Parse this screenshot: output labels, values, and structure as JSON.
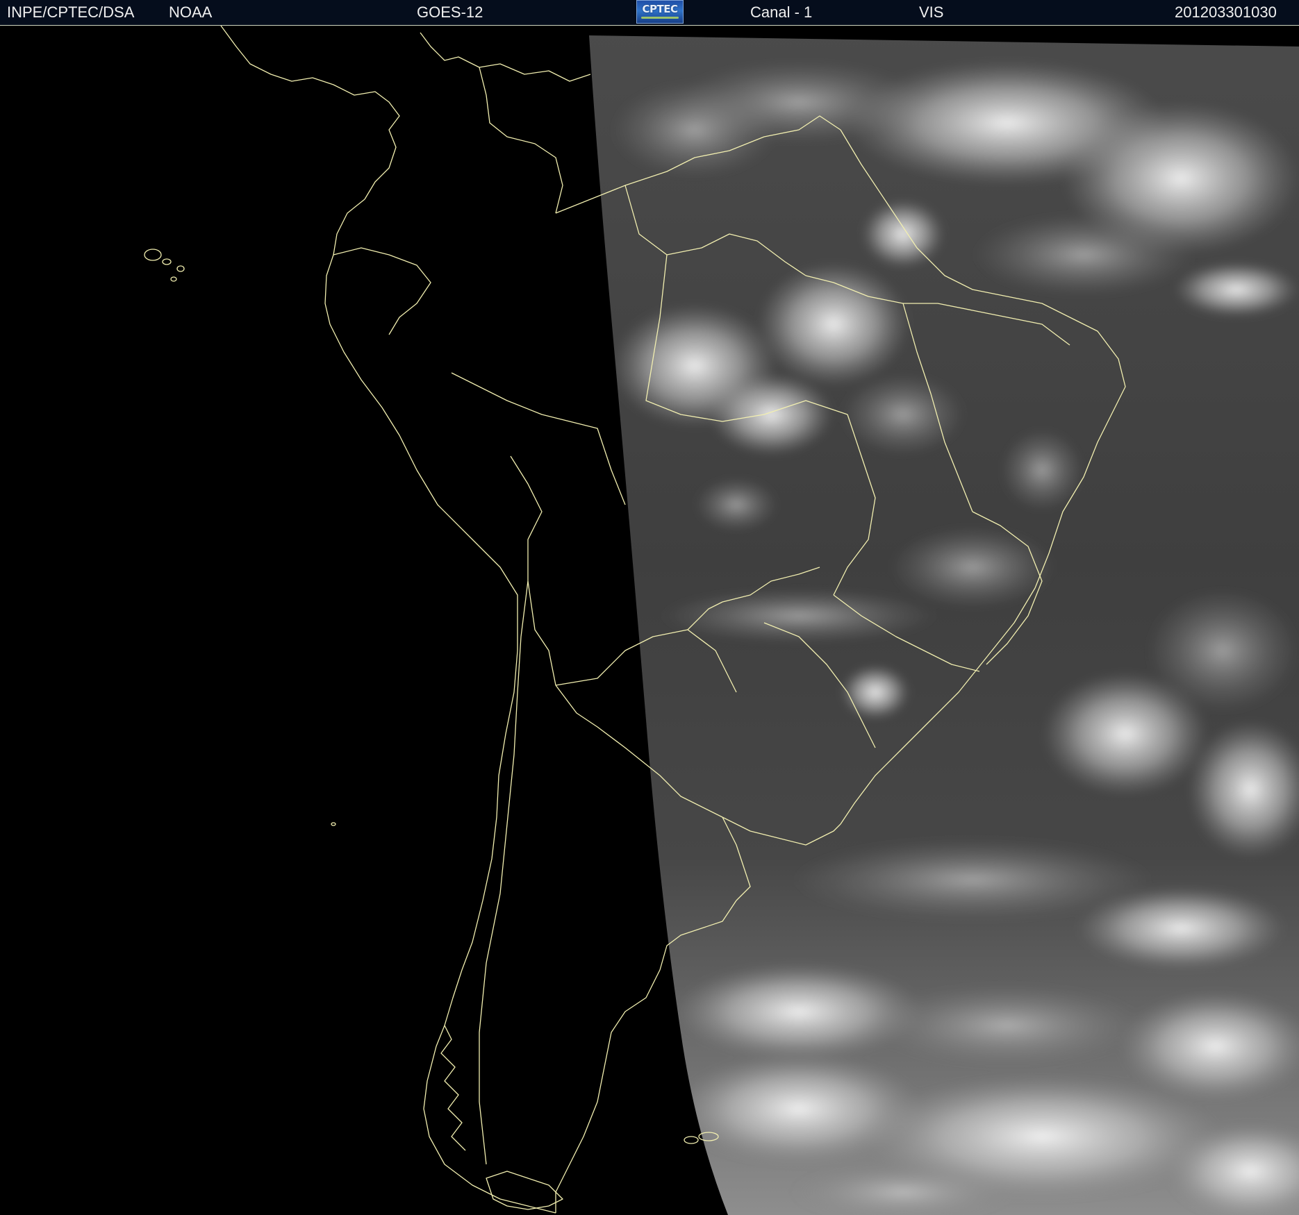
{
  "header": {
    "source": "INPE/CPTEC/DSA",
    "agency": "NOAA",
    "satellite": "GOES-12",
    "logo_text": "CPTEC",
    "channel": "Canal - 1",
    "band": "VIS",
    "timestamp": "201203301030"
  },
  "colors": {
    "header_background": "#050d1c",
    "header_text": "#f0f0f0",
    "space_background": "#000000",
    "boundary_lines": "#f2efb0",
    "cloud_white": "#f2f2f2",
    "surface_gray": "#4a4a4a"
  },
  "imagery": {
    "type": "satellite-visible-channel",
    "projection_edge": "western limb curved, no data to the west"
  }
}
